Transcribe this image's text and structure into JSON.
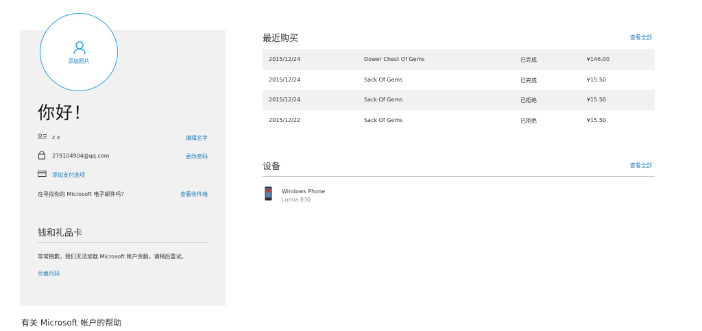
{
  "profile": {
    "add_photo_label": "添加照片",
    "greeting": "你好！",
    "name": "z x",
    "edit_name": "编辑名字",
    "email": "279104904@qq.com",
    "change_password": "更改密码",
    "add_payment": "添加支付选项",
    "find_email_prompt": "在寻找你的 Microsoft 电子邮件吗？",
    "view_inbox": "查看收件箱"
  },
  "wallet": {
    "title": "钱和礼品卡",
    "message": "非常抱歉，我们无法加载 Microsoft 帐户余额。请稍后重试。",
    "redeem_code": "兑换代码"
  },
  "help_link": "有关 Microsoft 帐户的帮助",
  "purchases": {
    "title": "最近购买",
    "see_all": "查看全部",
    "rows": [
      {
        "date": "2015/12/24",
        "item": "Dower Chest Of Gems",
        "status": "已完成",
        "price": "¥146.00"
      },
      {
        "date": "2015/12/24",
        "item": "Sack Of Gems",
        "status": "已完成",
        "price": "¥15.50"
      },
      {
        "date": "2015/12/24",
        "item": "Sack Of Gems",
        "status": "已拒绝",
        "price": "¥15.50"
      },
      {
        "date": "2015/12/22",
        "item": "Sack Of Gems",
        "status": "已拒绝",
        "price": "¥15.50"
      }
    ]
  },
  "devices": {
    "title": "设备",
    "see_all": "查看全部",
    "items": [
      {
        "name": "Windows Phone",
        "model": "Lumia 830"
      }
    ]
  },
  "colors": {
    "accent": "#1ba1e2",
    "link": "#1b7fbf",
    "panel_bg": "#f1f1f1"
  }
}
